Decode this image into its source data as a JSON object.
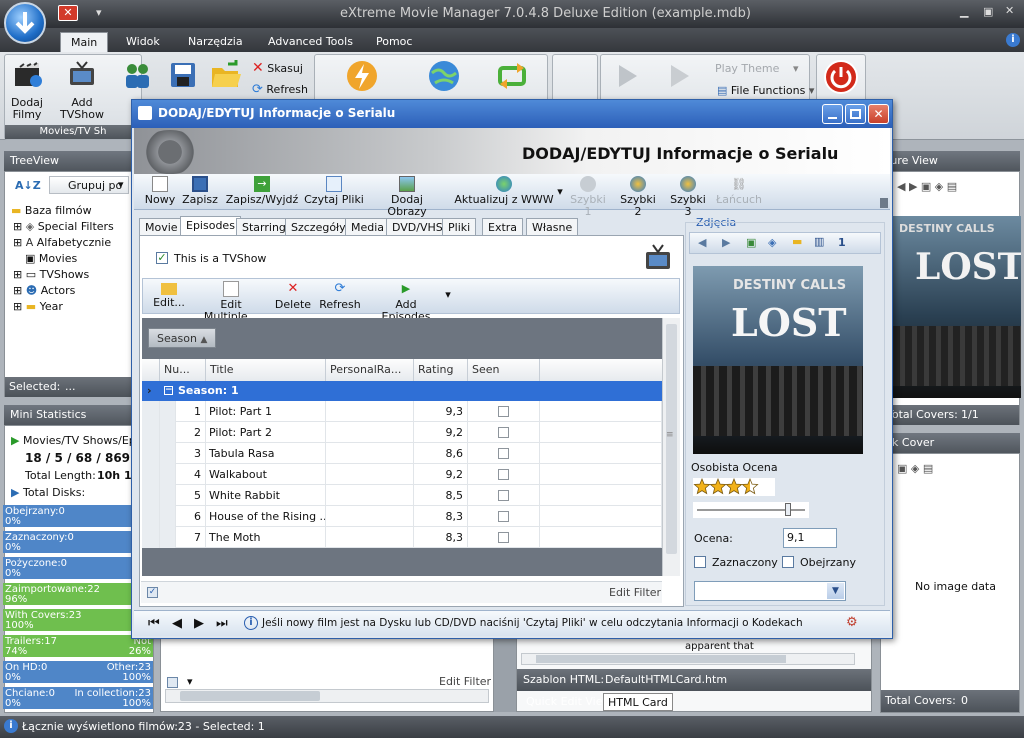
{
  "app": {
    "title": "eXtreme Movie Manager 7.0.4.8 Deluxe Edition (example.mdb)",
    "tabs": [
      "Main",
      "Widok",
      "Narzędzia",
      "Advanced Tools",
      "Pomoc"
    ]
  },
  "ribbon": {
    "dodaj_filmy": "Dodaj\nFilmy",
    "add_tvshow": "Add TVShow",
    "skasuj": "Skasuj",
    "refresh": "Refresh",
    "group_label": "Movies/TV Sh",
    "play_theme": "Play Theme",
    "file_functions": "File Functions"
  },
  "treeview": {
    "title": "TreeView",
    "grupuj": "Grupuj po",
    "items": [
      "Baza filmów",
      "Special Filters",
      "Alfabetycznie",
      "Movies",
      "TVShows",
      "Actors",
      "Year"
    ],
    "selected_label": "Selected:",
    "selected_value": "..."
  },
  "mini_stats": {
    "title": "Mini Statistics",
    "movies_tv": "Movies/TV Shows/Epis",
    "counts": "18 / 5 / 68 / 869",
    "total_length_label": "Total Length:",
    "total_length": "10h 14",
    "total_disks": "Total Disks:",
    "rows": [
      {
        "left": "Obejrzany:0",
        "right": "No",
        "pct": "0%",
        "pct2": "1"
      },
      {
        "left": "Zaznaczony:0",
        "right": "No",
        "pct": "0%",
        "pct2": "1"
      },
      {
        "left": "Pożyczone:0",
        "right": "No",
        "pct": "0%",
        "pct2": "1"
      },
      {
        "left": "Zaimportowane:22",
        "right": "N",
        "pct": "96%",
        "pct2": ""
      },
      {
        "left": "With Covers:23",
        "right": "N",
        "pct": "100%",
        "pct2": ""
      },
      {
        "left": "Trailers:17",
        "right": "Not",
        "pct": "74%",
        "pct2": "26%"
      },
      {
        "left": "On HD:0",
        "right": "Other:23",
        "pct": "0%",
        "pct2": "100%"
      },
      {
        "left": "Chciane:0",
        "right": "In collection:23",
        "pct": "0%",
        "pct2": "100%"
      }
    ]
  },
  "right_panels": {
    "picture_view": "ture View",
    "total_covers1_label": "Total Covers:",
    "total_covers1": "1/1",
    "back_cover": "ck Cover",
    "no_image": "No image data",
    "total_covers2_label": "Total Covers:",
    "total_covers2": "0",
    "poster_title_top": "DESTINY CALLS",
    "poster_title": "LOST"
  },
  "bottom": {
    "edit_filter": "Edit Filter",
    "apparent": "apparent that",
    "szablon_label": "Szablon HTML:",
    "szablon_value": "DefaultHTMLCard.htm",
    "quick_edit": "Quick Edit View",
    "html_card": "HTML Card"
  },
  "status": {
    "text": "Łącznie wyświetlono filmów:23 - Selected: 1"
  },
  "dialog": {
    "title": "DODAJ/EDYTUJ Informacje o Serialu",
    "banner": "DODAJ/EDYTUJ Informacje o Serialu",
    "toolbar": [
      "Nowy",
      "Zapisz",
      "Zapisz/Wyjdź",
      "Czytaj Pliki",
      "Dodaj Obrazy",
      "Aktualizuj z WWW",
      "Szybki 1",
      "Szybki 2",
      "Szybki 3",
      "Łańcuch"
    ],
    "tabs": [
      "Movie",
      "Episodes",
      "Starring",
      "Szczegóły",
      "Media",
      "DVD/VHS",
      "Pliki",
      "Extra",
      "Własne"
    ],
    "tvshow_label": "This is a TVShow",
    "ep_toolbar": [
      "Edit...",
      "Edit Multiple...",
      "Delete",
      "Refresh",
      "Add Episodes"
    ],
    "season_group": "Season",
    "columns": [
      "Nu...",
      "Title",
      "PersonalRa...",
      "Rating",
      "Seen"
    ],
    "group_row": "Season: 1",
    "episodes": [
      {
        "num": "1",
        "title": "Pilot: Part 1",
        "rating": "9,3"
      },
      {
        "num": "2",
        "title": "Pilot: Part 2",
        "rating": "9,2"
      },
      {
        "num": "3",
        "title": "Tabula Rasa",
        "rating": "8,6"
      },
      {
        "num": "4",
        "title": "Walkabout",
        "rating": "9,2"
      },
      {
        "num": "5",
        "title": "White Rabbit",
        "rating": "8,5"
      },
      {
        "num": "6",
        "title": "House of the Rising ...",
        "rating": "8,3"
      },
      {
        "num": "7",
        "title": "The Moth",
        "rating": "8,3"
      }
    ],
    "edit_filter": "Edit Filter",
    "zdjecia": "Zdjęcia",
    "image_index": "1",
    "osobista_ocena": "Osobista Ocena",
    "stars": 3.5,
    "ocena_label": "Ocena:",
    "ocena_value": "9,1",
    "zaznaczony": "Zaznaczony",
    "obejrzany": "Obejrzany",
    "info": "Jeśli nowy film jest na Dysku lub CD/DVD naciśnij 'Czytaj Pliki' w celu odczytania Informacji o Kodekach"
  }
}
